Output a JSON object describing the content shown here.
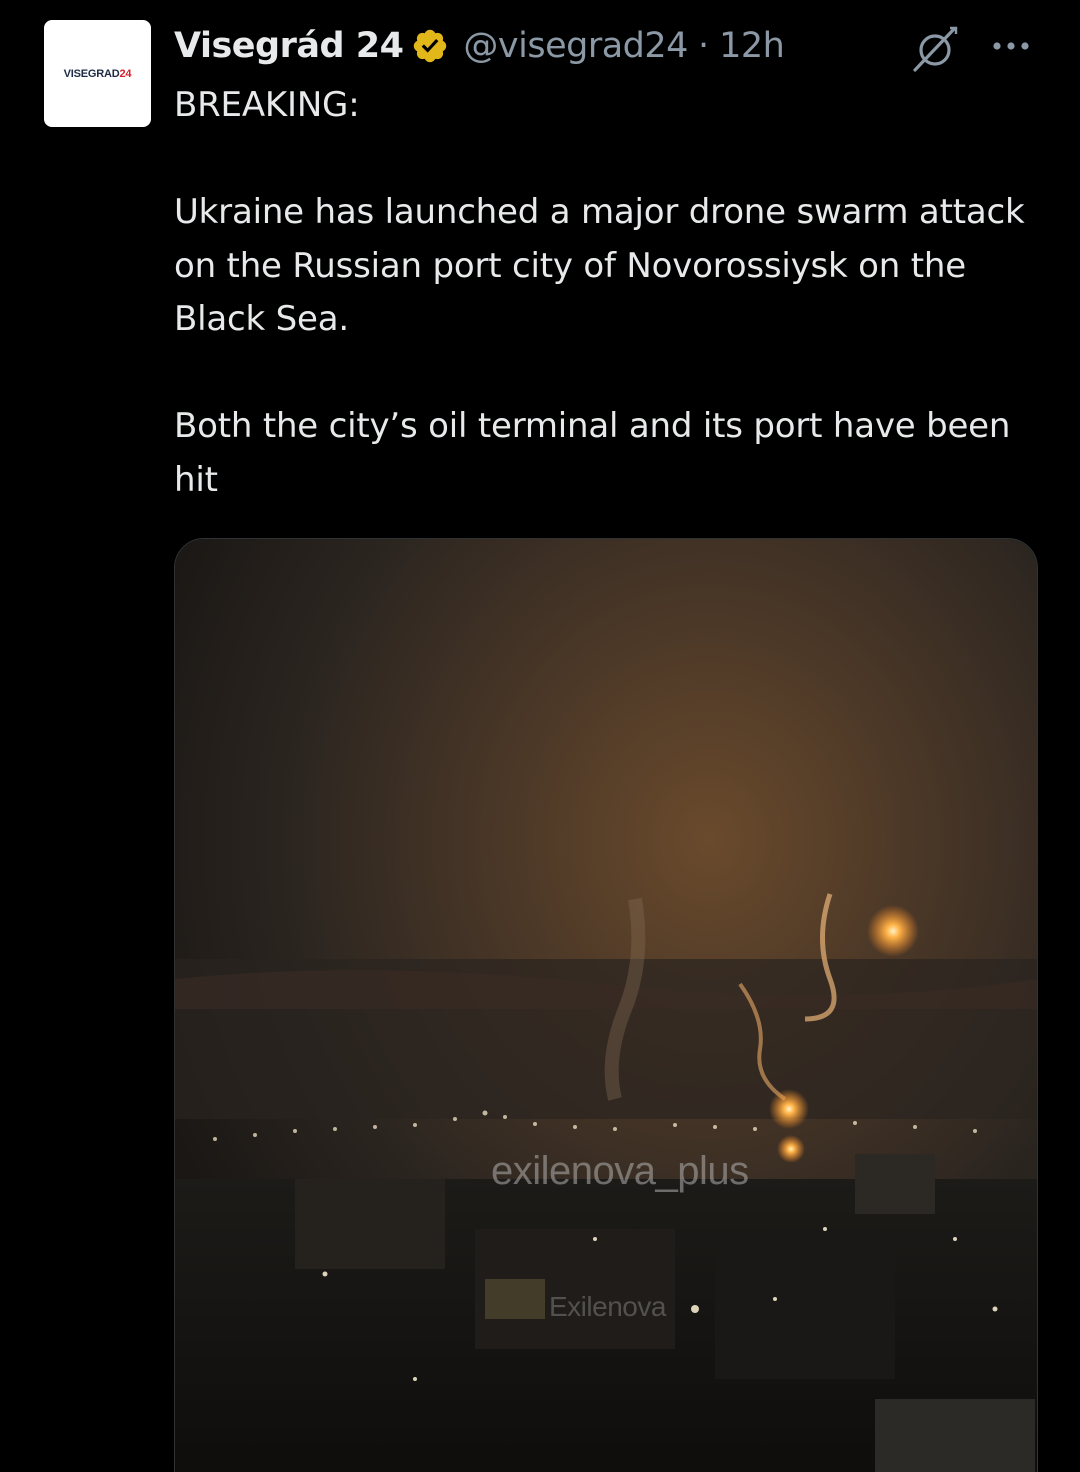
{
  "author": {
    "avatar_text_main": "VISEGRAD",
    "avatar_text_accent": "24",
    "display_name": "Visegrád 24",
    "handle": "@visegrad24",
    "separator": "·",
    "timestamp": "12h",
    "verified_color": "#e2b719"
  },
  "tweet": {
    "line1": "BREAKING:",
    "paragraph2": "Ukraine has launched a major drone swarm attack on the Russian port city of Novorossiysk on the Black Sea.",
    "paragraph3": "Both the city’s oil terminal and its port have been hit"
  },
  "media": {
    "watermark_primary": "exilenova_plus",
    "watermark_secondary": "Exilenova"
  },
  "icons": {
    "grok": "grok-icon",
    "more": "more-icon",
    "verified": "verified-badge-icon"
  },
  "colors": {
    "background": "#000000",
    "text_primary": "#e7e9ea",
    "text_secondary": "#8b98a5"
  }
}
